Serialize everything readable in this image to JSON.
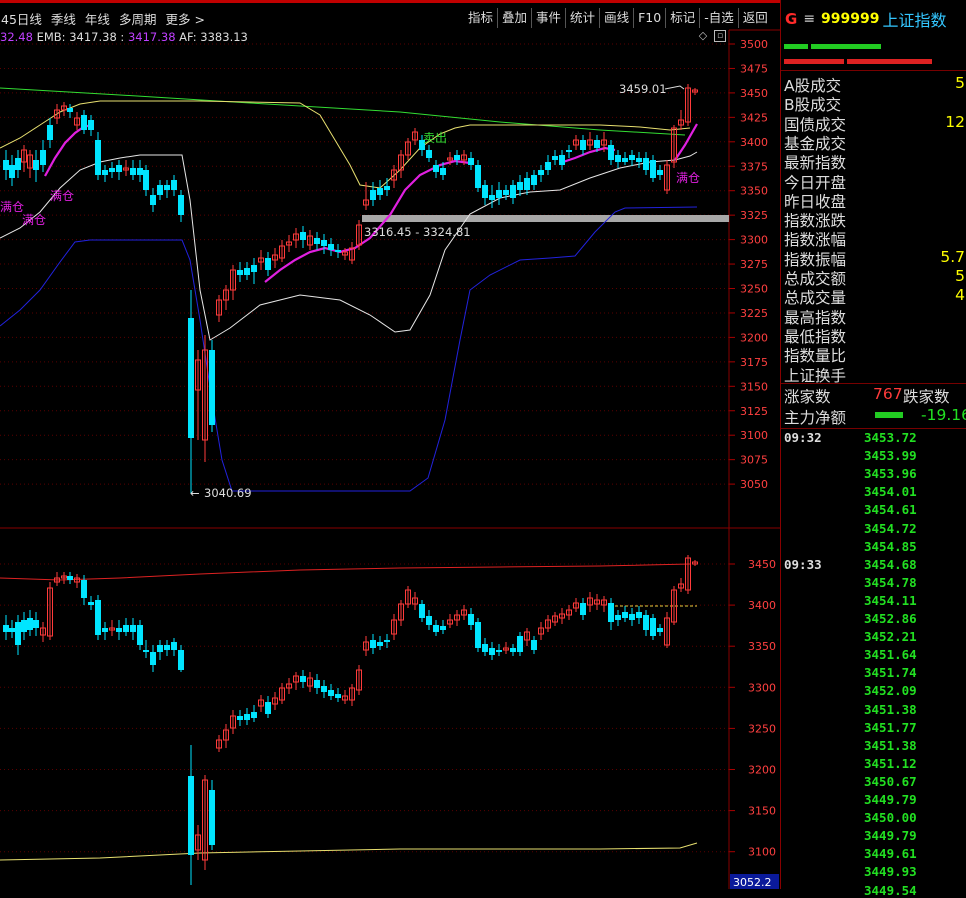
{
  "toolbar": {
    "periods": [
      "45日线",
      "季线",
      "年线",
      "多周期",
      "更多"
    ],
    "tools": [
      "指标",
      "叠加",
      "事件",
      "统计",
      "画线",
      "F10",
      "标记",
      "-自选",
      "返回"
    ]
  },
  "legend": {
    "ema_partial": "32.48",
    "emb_label": "EMB:",
    "emb_value": "3417.38",
    "emb_value2": "3417.38",
    "af_label": "AF:",
    "af_value": "3383.13"
  },
  "chart": {
    "upper_ticks": [
      "3500",
      "3475",
      "3450",
      "3425",
      "3400",
      "3375",
      "3350",
      "3325",
      "3300",
      "3275",
      "3250",
      "3225",
      "3200",
      "3175",
      "3150",
      "3125",
      "3100",
      "3075",
      "3050"
    ],
    "lower_ticks": [
      "3450",
      "3400",
      "3350",
      "3300",
      "3250",
      "3200",
      "3150",
      "3100"
    ],
    "annotations": {
      "high": "3459.01",
      "low": "3040.69",
      "range": "3316.45 - 3324.81",
      "sell": "卖出",
      "full_positions": [
        "满仓",
        "满仓",
        "满仓",
        "满仓"
      ]
    },
    "bottom_price": "3052.2",
    "up_color": "#ff3b3b",
    "down_color": "#00e5ff"
  },
  "panel": {
    "menu_icon": "hamburger-icon",
    "brand": "G",
    "code": "999999",
    "name": "上证指数",
    "stats": [
      {
        "label": "A股成交",
        "value": "5"
      },
      {
        "label": "B股成交",
        "value": ""
      },
      {
        "label": "国债成交",
        "value": "12"
      },
      {
        "label": "基金成交",
        "value": ""
      },
      {
        "label": "最新指数",
        "value": ""
      },
      {
        "label": "今日开盘",
        "value": ""
      },
      {
        "label": "昨日收盘",
        "value": ""
      },
      {
        "label": "指数涨跌",
        "value": ""
      },
      {
        "label": "指数涨幅",
        "value": ""
      },
      {
        "label": "指数振幅",
        "value": "5.7"
      },
      {
        "label": "总成交额",
        "value": "5"
      },
      {
        "label": "总成交量",
        "value": "4"
      },
      {
        "label": "最高指数",
        "value": ""
      },
      {
        "label": "最低指数",
        "value": ""
      },
      {
        "label": "指数量比",
        "value": ""
      },
      {
        "label": "上证换手",
        "value": ""
      }
    ],
    "up_label": "涨家数",
    "up_count": "767",
    "down_label": "跌家数",
    "flow_label": "主力净额",
    "flow_value": "-19.16",
    "ticks": [
      {
        "time": "09:32",
        "price": "3453.72"
      },
      {
        "time": "",
        "price": "3453.99"
      },
      {
        "time": "",
        "price": "3453.96"
      },
      {
        "time": "",
        "price": "3454.01"
      },
      {
        "time": "",
        "price": "3454.61"
      },
      {
        "time": "",
        "price": "3454.72"
      },
      {
        "time": "",
        "price": "3454.85"
      },
      {
        "time": "09:33",
        "price": "3454.68"
      },
      {
        "time": "",
        "price": "3454.78"
      },
      {
        "time": "",
        "price": "3454.11"
      },
      {
        "time": "",
        "price": "3452.86"
      },
      {
        "time": "",
        "price": "3452.21"
      },
      {
        "time": "",
        "price": "3451.64"
      },
      {
        "time": "",
        "price": "3451.74"
      },
      {
        "time": "",
        "price": "3452.09"
      },
      {
        "time": "",
        "price": "3451.38"
      },
      {
        "time": "",
        "price": "3451.77"
      },
      {
        "time": "",
        "price": "3451.38"
      },
      {
        "time": "",
        "price": "3451.12"
      },
      {
        "time": "",
        "price": "3450.67"
      },
      {
        "time": "",
        "price": "3449.79"
      },
      {
        "time": "",
        "price": "3450.00"
      },
      {
        "time": "",
        "price": "3449.79"
      },
      {
        "time": "",
        "price": "3449.61"
      },
      {
        "time": "",
        "price": "3449.93"
      },
      {
        "time": "",
        "price": "3449.54"
      }
    ]
  }
}
